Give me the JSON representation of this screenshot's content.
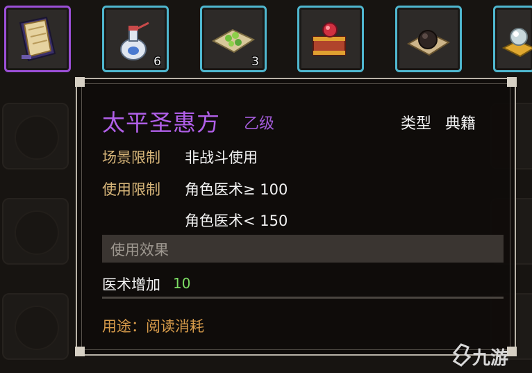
{
  "inventory": {
    "items": [
      {
        "icon": "scroll-book-icon",
        "count": ""
      },
      {
        "icon": "medicine-bottle-icon",
        "count": "6"
      },
      {
        "icon": "herb-pouch-icon",
        "count": "3"
      },
      {
        "icon": "treasure-chest-icon",
        "count": ""
      },
      {
        "icon": "black-pill-icon",
        "count": ""
      },
      {
        "icon": "crystal-ore-icon",
        "count": ""
      }
    ]
  },
  "tooltip": {
    "title": "太平圣惠方",
    "grade": "乙级",
    "type_label": "类型",
    "type_value": "典籍",
    "scene_label": "场景限制",
    "scene_value": "非战斗使用",
    "use_label": "使用限制",
    "use_value_1": "角色医术≥ 100",
    "use_value_2": "角色医术< 150",
    "effect_header": "使用效果",
    "effect_name": "医术增加",
    "effect_value": "10",
    "usage": "用途：阅读消耗"
  },
  "watermark": {
    "text": "九游"
  },
  "colors": {
    "accent_selected": "#9b4fd6",
    "slot_border": "#4fb7cf",
    "title": "#b05fe8",
    "label": "#d9b77a",
    "effect_value": "#7dde64",
    "usage": "#d79b4a"
  }
}
